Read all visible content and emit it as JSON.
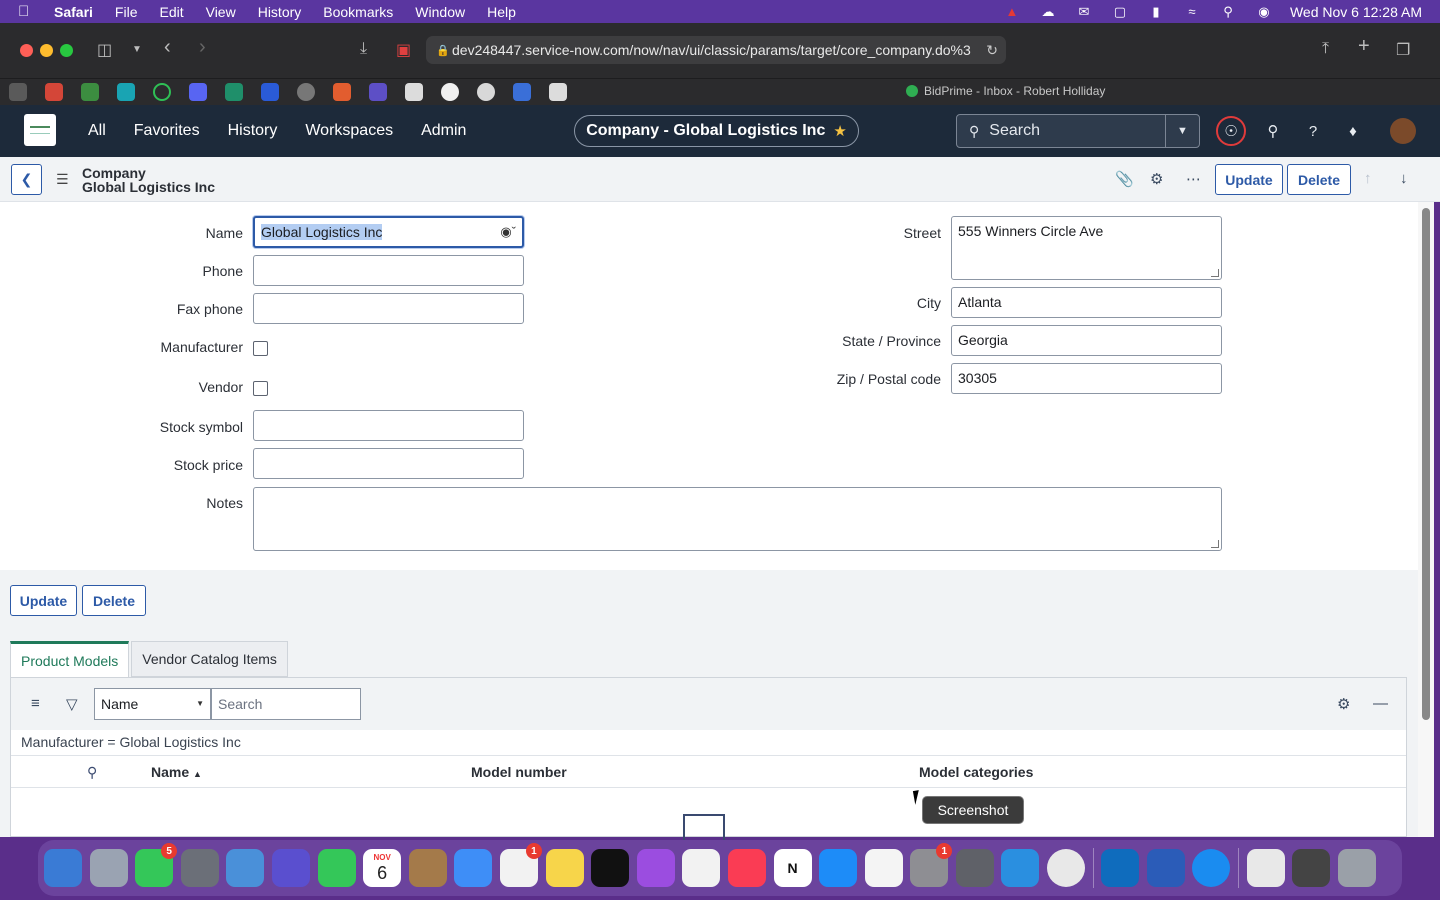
{
  "menubar": {
    "apple": "",
    "items": [
      "Safari",
      "File",
      "Edit",
      "View",
      "History",
      "Bookmarks",
      "Window",
      "Help"
    ],
    "clock": "Wed Nov 6  12:28 AM"
  },
  "safari": {
    "url": "dev248447.service-now.com/now/nav/ui/classic/params/target/core_company.do%3",
    "tab_title": "BidPrime - Inbox - Robert Holliday"
  },
  "sn": {
    "nav": [
      "All",
      "Favorites",
      "History",
      "Workspaces",
      "Admin"
    ],
    "context_pill": "Company - Global Logistics Inc",
    "search_placeholder": "Search"
  },
  "form_header": {
    "table": "Company",
    "record": "Global Logistics Inc",
    "update_label": "Update",
    "delete_label": "Delete"
  },
  "form": {
    "name_label": "Name",
    "name_value": "Global Logistics Inc",
    "phone_label": "Phone",
    "phone_value": "",
    "fax_label": "Fax phone",
    "fax_value": "",
    "manufacturer_label": "Manufacturer",
    "manufacturer_checked": false,
    "vendor_label": "Vendor",
    "vendor_checked": false,
    "stock_symbol_label": "Stock symbol",
    "stock_price_label": "Stock price",
    "notes_label": "Notes",
    "street_label": "Street",
    "street_value": "555 Winners Circle Ave",
    "city_label": "City",
    "city_value": "Atlanta",
    "state_label": "State / Province",
    "state_value": "Georgia",
    "zip_label": "Zip / Postal code",
    "zip_value": "30305"
  },
  "bottom_buttons": {
    "update": "Update",
    "delete": "Delete"
  },
  "related": {
    "tabs": [
      "Product Models",
      "Vendor Catalog Items"
    ],
    "filter_field": "Name",
    "search_placeholder": "Search",
    "breadcrumb": "Manufacturer = Global Logistics Inc",
    "columns": [
      "Name",
      "Model number",
      "Model categories"
    ],
    "sort_indicator": "▲"
  },
  "tooltip": "Screenshot",
  "dock": {
    "badges": {
      "messages": "5",
      "reminders": "1",
      "settings": "1"
    },
    "calendar_month": "NOV",
    "calendar_day": "6"
  }
}
